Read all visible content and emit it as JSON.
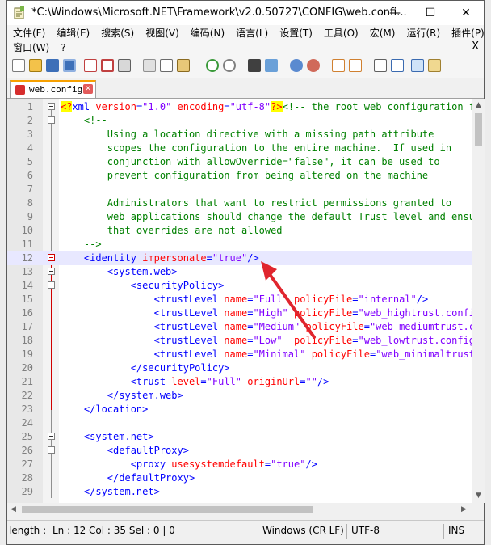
{
  "window": {
    "title": "*C:\\Windows\\Microsoft.NET\\Framework\\v2.0.50727\\CONFIG\\web.confi...",
    "minimize": "—",
    "maximize": "☐",
    "close": "✕"
  },
  "menu": {
    "row1": [
      "文件(F)",
      "编辑(E)",
      "搜索(S)",
      "视图(V)",
      "编码(N)",
      "语言(L)",
      "设置(T)",
      "工具(O)",
      "宏(M)",
      "运行(R)",
      "插件(P)"
    ],
    "row2": [
      "窗口(W)",
      "?"
    ],
    "close_doc": "X"
  },
  "tab": {
    "label": "web.config",
    "close": "✕"
  },
  "editor": {
    "lines": [
      {
        "n": "1",
        "fold": "box",
        "html": "<span class=\"xmlhl\">&lt;?</span><span class=\"tag\">xml </span><span class=\"attr\">version</span><span class=\"tag\">=</span><span class=\"val\">\"1.0\"</span><span class=\"tag\"> </span><span class=\"attr\">encoding</span><span class=\"tag\">=</span><span class=\"val\">\"utf-8\"</span><span class=\"xmlhl\">?&gt;</span><span class=\"cmt\">&lt;!-- the root web configuration file</span>"
      },
      {
        "n": "2",
        "fold": "box",
        "html": "    <span class=\"cmt\">&lt;!--</span>"
      },
      {
        "n": "3",
        "fold": "",
        "html": "        <span class=\"cmt\">Using a location directive with a missing path attribute</span>"
      },
      {
        "n": "4",
        "fold": "",
        "html": "        <span class=\"cmt\">scopes the configuration to the entire machine.  If used in</span>"
      },
      {
        "n": "5",
        "fold": "",
        "html": "        <span class=\"cmt\">conjunction with allowOverride=\"false\", it can be used to</span>"
      },
      {
        "n": "6",
        "fold": "",
        "html": "        <span class=\"cmt\">prevent configuration from being altered on the machine</span>"
      },
      {
        "n": "7",
        "fold": "",
        "html": ""
      },
      {
        "n": "8",
        "fold": "",
        "html": "        <span class=\"cmt\">Administrators that want to restrict permissions granted to</span>"
      },
      {
        "n": "9",
        "fold": "",
        "html": "        <span class=\"cmt\">web applications should change the default Trust level and ensure</span>"
      },
      {
        "n": "10",
        "fold": "",
        "html": "        <span class=\"cmt\">that overrides are not allowed</span>"
      },
      {
        "n": "11",
        "fold": "",
        "html": "    <span class=\"cmt\">--&gt;</span>"
      },
      {
        "n": "12",
        "fold": "red",
        "current": true,
        "html": "    <span class=\"tag\">&lt;identity </span><span class=\"attr\">impersonate</span><span class=\"tag\">=</span><span class=\"val\">\"true\"</span><span class=\"tag\">/&gt;</span>"
      },
      {
        "n": "13",
        "fold": "box",
        "html": "        <span class=\"tag\">&lt;system.web&gt;</span>"
      },
      {
        "n": "14",
        "fold": "box",
        "html": "            <span class=\"tag\">&lt;securityPolicy&gt;</span>"
      },
      {
        "n": "15",
        "fold": "",
        "html": "                <span class=\"tag\">&lt;trustLevel </span><span class=\"attr\">name</span><span class=\"tag\">=</span><span class=\"val\">\"Full\"</span><span class=\"tag\"> </span><span class=\"attr\">policyFile</span><span class=\"tag\">=</span><span class=\"val\">\"internal\"</span><span class=\"tag\">/&gt;</span>"
      },
      {
        "n": "16",
        "fold": "",
        "html": "                <span class=\"tag\">&lt;trustLevel </span><span class=\"attr\">name</span><span class=\"tag\">=</span><span class=\"val\">\"High\"</span><span class=\"tag\"> </span><span class=\"attr\">policyFile</span><span class=\"tag\">=</span><span class=\"val\">\"web_hightrust.config\"</span><span class=\"tag\">/&gt;</span>"
      },
      {
        "n": "17",
        "fold": "",
        "html": "                <span class=\"tag\">&lt;trustLevel </span><span class=\"attr\">name</span><span class=\"tag\">=</span><span class=\"val\">\"Medium\"</span><span class=\"tag\"> </span><span class=\"attr\">policyFile</span><span class=\"tag\">=</span><span class=\"val\">\"web_mediumtrust.config\"</span><span class=\"tag\">/&gt;</span>"
      },
      {
        "n": "18",
        "fold": "",
        "html": "                <span class=\"tag\">&lt;trustLevel </span><span class=\"attr\">name</span><span class=\"tag\">=</span><span class=\"val\">\"Low\"</span><span class=\"tag\">  </span><span class=\"attr\">policyFile</span><span class=\"tag\">=</span><span class=\"val\">\"web_lowtrust.config\"</span><span class=\"tag\">/&gt;</span>"
      },
      {
        "n": "19",
        "fold": "",
        "html": "                <span class=\"tag\">&lt;trustLevel </span><span class=\"attr\">name</span><span class=\"tag\">=</span><span class=\"val\">\"Minimal\"</span><span class=\"tag\"> </span><span class=\"attr\">policyFile</span><span class=\"tag\">=</span><span class=\"val\">\"web_minimaltrust.config\"</span><span class=\"tag\">/&gt;</span>"
      },
      {
        "n": "20",
        "fold": "",
        "html": "            <span class=\"tag\">&lt;/securityPolicy&gt;</span>"
      },
      {
        "n": "21",
        "fold": "",
        "html": "            <span class=\"tag\">&lt;trust </span><span class=\"attr\">level</span><span class=\"tag\">=</span><span class=\"val\">\"Full\"</span><span class=\"tag\"> </span><span class=\"attr\">originUrl</span><span class=\"tag\">=</span><span class=\"val\">\"\"</span><span class=\"tag\">/&gt;</span>"
      },
      {
        "n": "22",
        "fold": "",
        "html": "        <span class=\"tag\">&lt;/system.web&gt;</span>"
      },
      {
        "n": "23",
        "fold": "",
        "html": "    <span class=\"tag\">&lt;/location&gt;</span>"
      },
      {
        "n": "24",
        "fold": "",
        "html": ""
      },
      {
        "n": "25",
        "fold": "box",
        "html": "    <span class=\"tag\">&lt;system.net&gt;</span>"
      },
      {
        "n": "26",
        "fold": "box",
        "html": "        <span class=\"tag\">&lt;defaultProxy&gt;</span>"
      },
      {
        "n": "27",
        "fold": "",
        "html": "            <span class=\"tag\">&lt;proxy </span><span class=\"attr\">usesystemdefault</span><span class=\"tag\">=</span><span class=\"val\">\"true\"</span><span class=\"tag\">/&gt;</span>"
      },
      {
        "n": "28",
        "fold": "",
        "html": "        <span class=\"tag\">&lt;/defaultProxy&gt;</span>"
      },
      {
        "n": "29",
        "fold": "",
        "html": "    <span class=\"tag\">&lt;/system.net&gt;</span>"
      }
    ]
  },
  "status": {
    "length": "length :",
    "position": "Ln : 12    Col : 35    Sel : 0 | 0",
    "eol": "Windows (CR LF)",
    "encoding": "UTF-8",
    "mode": "INS"
  }
}
